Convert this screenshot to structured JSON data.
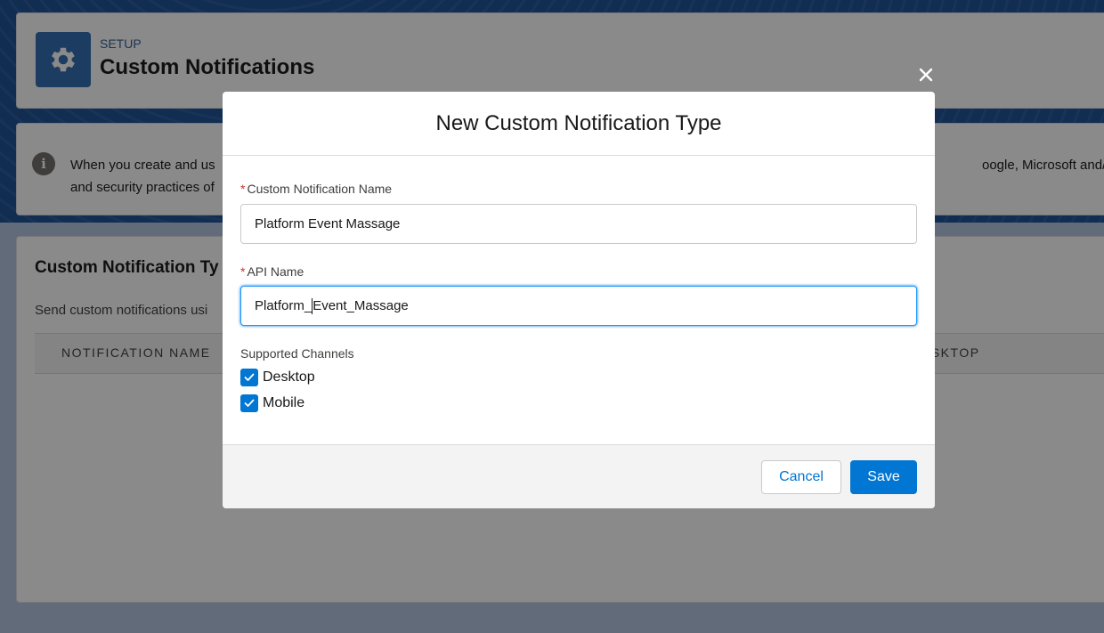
{
  "header": {
    "breadcrumb": "SETUP",
    "title": "Custom Notifications",
    "icon": "gear-icon"
  },
  "info_banner": {
    "icon": "info-icon",
    "line1_left": "When you create and us",
    "line1_right": "oogle, Microsoft and/or App",
    "line2_left": "and security practices of"
  },
  "list": {
    "title": "Custom Notification Ty",
    "subtitle": "Send custom notifications usi",
    "columns": [
      "NOTIFICATION NAME",
      "ESKTOP"
    ]
  },
  "modal": {
    "title": "New Custom Notification Type",
    "close_icon": "close-icon",
    "required_marker": "*",
    "name_field": {
      "label": "Custom Notification Name",
      "value": "Platform Event Massage"
    },
    "api_field": {
      "label": "API Name",
      "value_before_caret": "Platform_",
      "value_after_caret": "Event_Massage"
    },
    "channels": {
      "label": "Supported Channels",
      "options": [
        {
          "label": "Desktop",
          "checked": true
        },
        {
          "label": "Mobile",
          "checked": true
        }
      ]
    },
    "buttons": {
      "cancel": "Cancel",
      "save": "Save"
    }
  },
  "colors": {
    "brand": "#0176d3",
    "required": "#c23934",
    "overlay": "#080707"
  }
}
